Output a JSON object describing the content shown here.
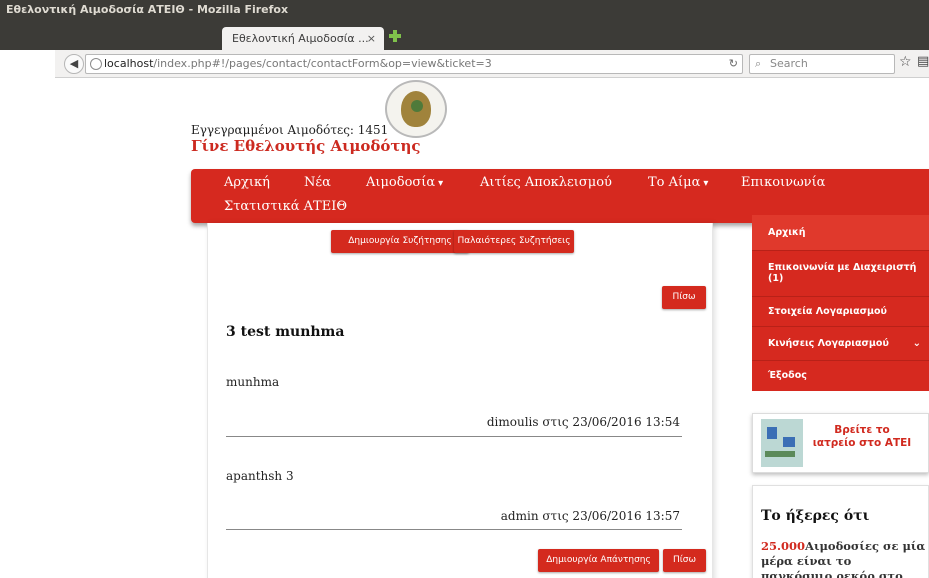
{
  "window": {
    "title": "Εθελοντική Αιμοδοσία ΑΤΕΙΘ - Mozilla Firefox"
  },
  "tab": {
    "label": "Εθελοντική Αιμοδοσία ...",
    "close_glyph": "×"
  },
  "url": {
    "host": "localhost",
    "path": "/index.php#!/pages/contact/contactForm&op=view&ticket=3"
  },
  "search": {
    "placeholder": "Search"
  },
  "header": {
    "donors_label": "Εγγεγραμμένοι Αιμοδότες: 1451",
    "become_donor": "Γίνε Εθελουτής Αιμοδότης"
  },
  "menu": {
    "home": "Αρχική",
    "news": "Νέα",
    "blood_donation": "Αιμοδοσία",
    "exclusion_reasons": "Αιτίες Αποκλεισμού",
    "blood": "Το Αίμα",
    "contact": "Επικοινωνία",
    "stats": "Στατιστικά ΑΤΕΙΘ",
    "caret_glyph": "▾"
  },
  "discussion": {
    "create_button": "Δημιουργία Συζήτησης",
    "older_button": "Παλαιότερες Συζητήσεις",
    "back_button": "Πίσω",
    "title": "3 test munhma",
    "messages": [
      {
        "body": "munhma",
        "meta": "dimoulis στις 23/06/2016 13:54"
      },
      {
        "body": "apanthsh 3",
        "meta": "admin στις 23/06/2016 13:57"
      }
    ],
    "reply_button": "Δημιουργία Απάντησης",
    "back_button_bottom": "Πίσω"
  },
  "sidebar": {
    "items": [
      {
        "label": "Αρχική"
      },
      {
        "label": "Επικοινωνία με Διαχειριστή (1)"
      },
      {
        "label": "Στοιχεία Λογαριασμού"
      },
      {
        "label": "Κινήσεις Λογαριασμού"
      },
      {
        "label": "Έξοδος"
      }
    ],
    "chevron_glyph": "⌄",
    "find_clinic": "Βρείτε το ιατρείο στο ΑΤΕΙ",
    "did_you_know_title": "Το ήξερες ότι",
    "did_you_know_number": "25.000",
    "did_you_know_text": "Αιμοδοσίες σε μία μέρα είναι το παγκόσμιο ρεκόρ στο"
  },
  "colors": {
    "accent": "#d6291f",
    "titlebar": "#3c3b37"
  }
}
